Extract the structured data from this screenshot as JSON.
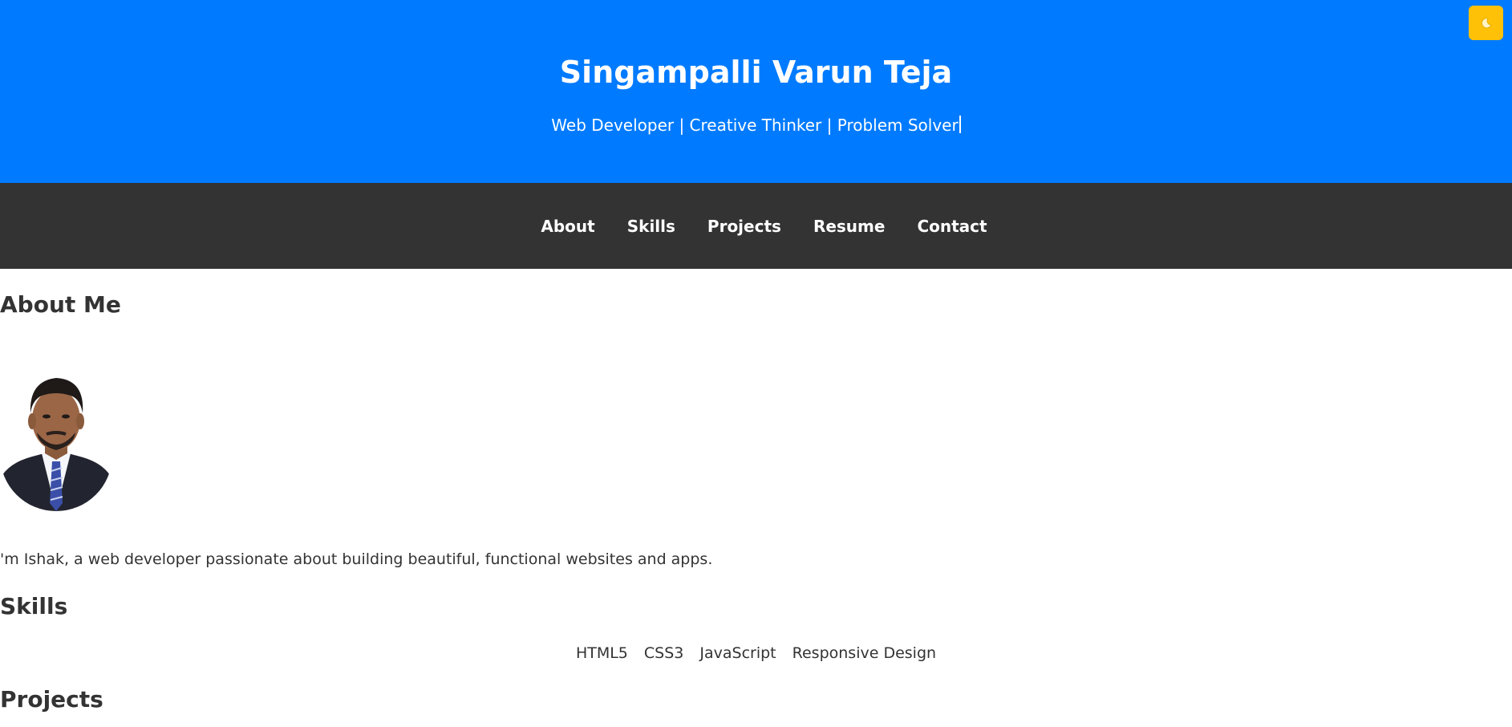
{
  "header": {
    "title": "Singampalli Varun Teja",
    "tagline": "Web Developer | Creative Thinker | Problem Solver",
    "theme_toggle_icon": "moon-icon",
    "colors": {
      "background": "#007bff",
      "toggle": "#ffc107"
    }
  },
  "nav": {
    "items": [
      {
        "label": "About"
      },
      {
        "label": "Skills"
      },
      {
        "label": "Projects"
      },
      {
        "label": "Resume"
      },
      {
        "label": "Contact"
      }
    ],
    "colors": {
      "background": "#333333"
    }
  },
  "about": {
    "title": "About Me",
    "avatar_icon": "profile-photo",
    "text": "'m Ishak, a web developer passionate about building beautiful, functional websites and apps."
  },
  "skills": {
    "title": "Skills",
    "items": [
      "HTML5",
      "CSS3",
      "JavaScript",
      "Responsive Design"
    ]
  },
  "projects": {
    "title": "Projects"
  }
}
